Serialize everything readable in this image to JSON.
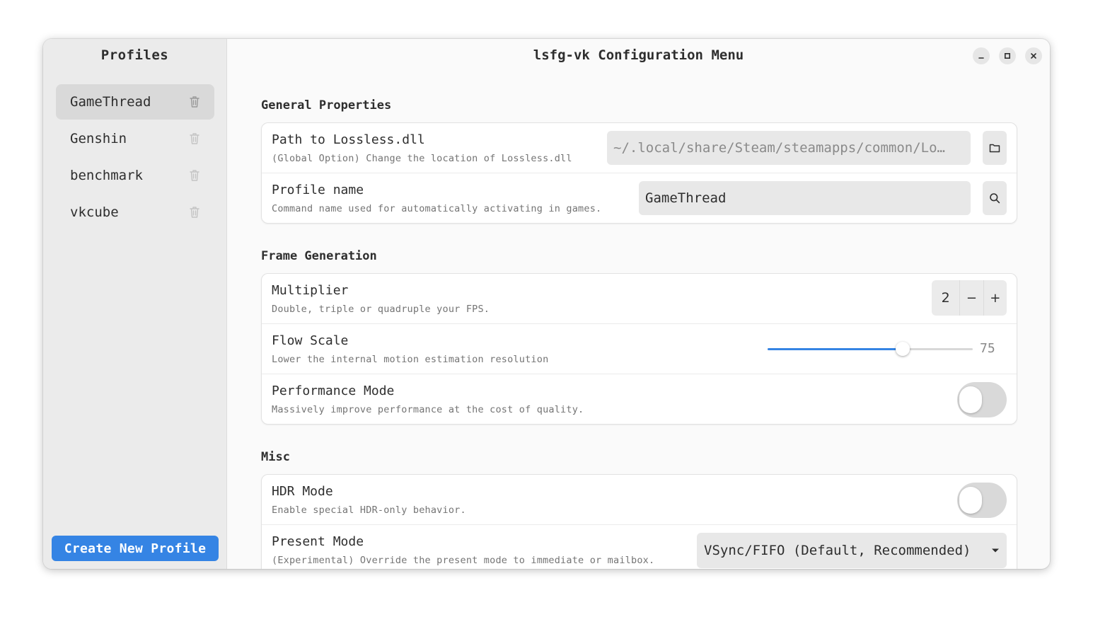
{
  "sidebar": {
    "title": "Profiles",
    "items": [
      {
        "label": "GameThread",
        "selected": true
      },
      {
        "label": "Genshin"
      },
      {
        "label": "benchmark"
      },
      {
        "label": "vkcube"
      }
    ],
    "create_button": "Create New Profile"
  },
  "header": {
    "title": "lsfg-vk Configuration Menu"
  },
  "general": {
    "title": "General Properties",
    "path": {
      "title": "Path to Lossless.dll",
      "subtitle": "(Global Option) Change the location of Lossless.dll",
      "value": "~/.local/share/Steam/steamapps/common/Lo…"
    },
    "profile_name": {
      "title": "Profile name",
      "subtitle": "Command name used for automatically activating in games.",
      "value": "GameThread"
    }
  },
  "framegen": {
    "title": "Frame Generation",
    "multiplier": {
      "title": "Multiplier",
      "subtitle": "Double, triple or quadruple your FPS.",
      "value": "2",
      "minus": "−",
      "plus": "+"
    },
    "flow_scale": {
      "title": "Flow Scale",
      "subtitle": "Lower the internal motion estimation resolution",
      "value": "75",
      "fraction": 0.66
    },
    "performance": {
      "title": "Performance Mode",
      "subtitle": "Massively improve performance at the cost of quality.",
      "enabled": false
    }
  },
  "misc": {
    "title": "Misc",
    "hdr": {
      "title": "HDR Mode",
      "subtitle": "Enable special HDR-only behavior.",
      "enabled": false
    },
    "present": {
      "title": "Present Mode",
      "subtitle": "(Experimental) Override the present mode to immediate or mailbox.",
      "value": "VSync/FIFO (Default, Recommended)"
    }
  },
  "colors": {
    "accent": "#3584e4",
    "sidebar_bg": "#ebebeb",
    "content_bg": "#fafafa"
  }
}
